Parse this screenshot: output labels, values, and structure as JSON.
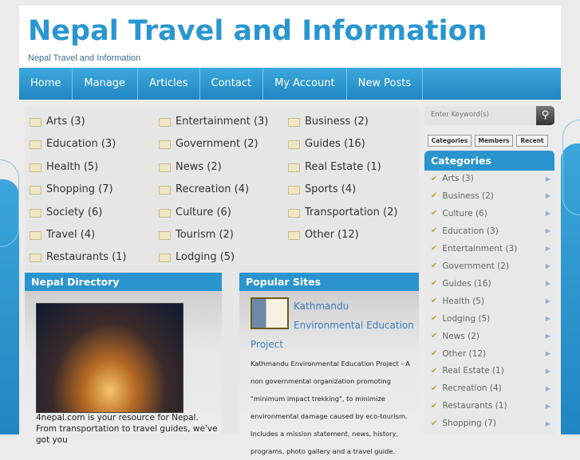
{
  "header": {
    "title": "Nepal Travel and Information",
    "tagline": "Nepal Travel and Information"
  },
  "nav": [
    "Home",
    "Manage",
    "Articles",
    "Contact",
    "My Account",
    "New Posts"
  ],
  "categories": [
    "Arts (3)",
    "Entertainment (3)",
    "Business (2)",
    "Education (3)",
    "Government (2)",
    "Guides (16)",
    "Health (5)",
    "News (2)",
    "Real Estate (1)",
    "Shopping (7)",
    "Recreation (4)",
    "Sports (4)",
    "Society (6)",
    "Culture (6)",
    "Transportation (2)",
    "Travel (4)",
    "Tourism (2)",
    "Other (12)",
    "Restaurants (1)",
    "Lodging (5)"
  ],
  "directory": {
    "title": "Nepal Directory",
    "text": "4nepal.com is your resource for Nepal. From transportation to travel guides, we've got you"
  },
  "popular": {
    "title": "Popular Sites",
    "link_line1": "Kathmandu",
    "link_line2": "Environmental Education",
    "link_line3": "Project",
    "description": "Kathmandu Environmental Education Project - A non governmental organization promoting \"minimum impact trekking\", to minimize environmental damage caused by eco-tourism. Includes a mission statement, news, history, programs, photo gallery and a travel guide."
  },
  "sidebar": {
    "search_placeholder": "Enter Keyword(s)",
    "tabs": [
      "Categories",
      "Members",
      "Recent"
    ],
    "title": "Categories",
    "items": [
      "Arts (3)",
      "Business (2)",
      "Culture (6)",
      "Education (3)",
      "Entertainment (3)",
      "Government (2)",
      "Guides (16)",
      "Health (5)",
      "Lodging (5)",
      "News (2)",
      "Other (12)",
      "Real Estate (1)",
      "Recreation (4)",
      "Restaurants (1)",
      "Shopping (7)"
    ]
  }
}
